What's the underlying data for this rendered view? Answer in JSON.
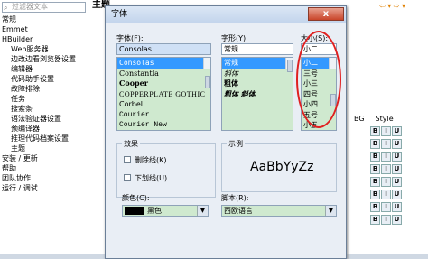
{
  "left_panel": {
    "filter_placeholder": "过滤器文本",
    "items": [
      "常规",
      "Emmet",
      "HBuilder",
      "Web服务器",
      "边改边看浏览器设置",
      "编辑器",
      "代码助手设置",
      "故障排除",
      "任务",
      "搜索条",
      "语法验证器设置",
      "预编译器",
      "推理代码档案设置",
      "主题",
      "安装 / 更新",
      "帮助",
      "团队协作",
      "运行 / 调试"
    ]
  },
  "right_panel": {
    "title": "主题",
    "col_bg": "BG",
    "col_style": "Style",
    "style_buttons": [
      "B",
      "I",
      "U"
    ]
  },
  "dialog": {
    "title": "字体",
    "close_label": "x",
    "font_label": "字体(F):",
    "font_value": "Consolas",
    "font_list": [
      "Consolas",
      "Constantia",
      "Cooper",
      "COPPERPLATE GOTHIC",
      "Corbel",
      "Courier",
      "Courier New"
    ],
    "style_label": "字形(Y):",
    "style_value": "常规",
    "style_list": [
      "常规",
      "斜体",
      "粗体",
      "粗体 斜体"
    ],
    "size_label": "大小(S):",
    "size_value": "小二",
    "size_list": [
      "小二",
      "三号",
      "小三",
      "四号",
      "小四",
      "五号",
      "小五"
    ],
    "effects_label": "效果",
    "strike_label": "删除线(K)",
    "underline_label": "下划线(U)",
    "color_label": "颜色(C):",
    "color_value": "黑色",
    "sample_label": "示例",
    "sample_text": "AaBbYyZz",
    "script_label": "脚本(R):",
    "script_value": "西欧语言",
    "accent_color": "#3399ff"
  }
}
